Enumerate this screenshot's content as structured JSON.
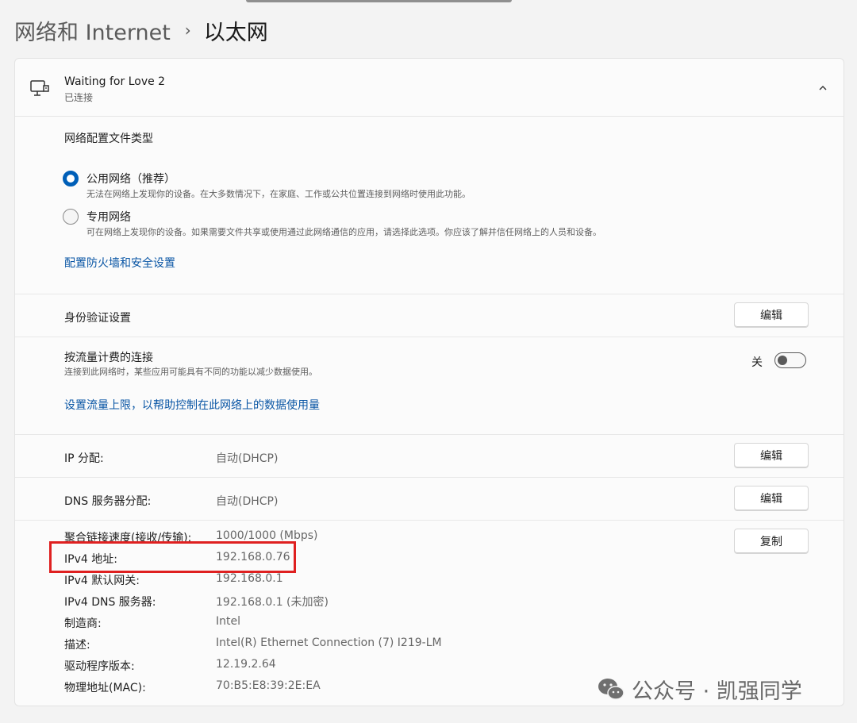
{
  "breadcrumb": {
    "parent": "网络和 Internet",
    "separator": "›",
    "current": "以太网"
  },
  "network": {
    "name": "Waiting for Love 2",
    "status": "已连接"
  },
  "profile": {
    "title": "网络配置文件类型",
    "options": [
      {
        "label": "公用网络（推荐）",
        "description": "无法在网络上发现你的设备。在大多数情况下，在家庭、工作或公共位置连接到网络时使用此功能。",
        "selected": true
      },
      {
        "label": "专用网络",
        "description": "可在网络上发现你的设备。如果需要文件共享或使用通过此网络通信的应用，请选择此选项。你应该了解并信任网络上的人员和设备。",
        "selected": false
      }
    ],
    "firewall_link": "配置防火墙和安全设置"
  },
  "auth": {
    "label": "身份验证设置",
    "button": "编辑"
  },
  "metered": {
    "label": "按流量计费的连接",
    "description": "连接到此网络时，某些应用可能具有不同的功能以减少数据使用。",
    "toggle_state": "关",
    "link": "设置流量上限，以帮助控制在此网络上的数据使用量"
  },
  "ip": {
    "label": "IP 分配:",
    "value": "自动(DHCP)",
    "button": "编辑"
  },
  "dns": {
    "label": "DNS 服务器分配:",
    "value": "自动(DHCP)",
    "button": "编辑"
  },
  "details": {
    "copy_button": "复制",
    "rows": [
      {
        "label": "聚合链接速度(接收/传输):",
        "value": "1000/1000 (Mbps)"
      },
      {
        "label": "IPv4 地址:",
        "value": "192.168.0.76"
      },
      {
        "label": "IPv4 默认网关:",
        "value": "192.168.0.1"
      },
      {
        "label": "IPv4 DNS 服务器:",
        "value": "192.168.0.1 (未加密)"
      },
      {
        "label": "制造商:",
        "value": "Intel"
      },
      {
        "label": "描述:",
        "value": "Intel(R) Ethernet Connection (7) I219-LM"
      },
      {
        "label": "驱动程序版本:",
        "value": "12.19.2.64"
      },
      {
        "label": "物理地址(MAC):",
        "value": "70:B5:E8:39:2E:EA"
      }
    ]
  },
  "watermark": {
    "text": "公众号 · 凯强同学"
  },
  "colors": {
    "accent": "#005fb8",
    "link": "#0a56a5",
    "highlight": "#df2020"
  }
}
